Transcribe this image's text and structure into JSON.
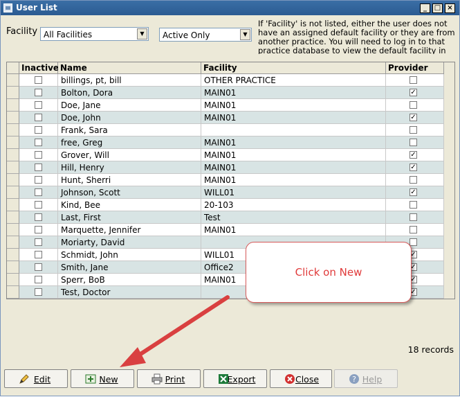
{
  "window": {
    "title": "User List"
  },
  "filters": {
    "facility_label": "Facility",
    "facility_value": "All Facilities",
    "status_value": "Active Only",
    "info_text": "If 'Facility' is not listed, either the user does not have an assigned default facility or they are from another practice. You will need to log in to that practice database to view the default facility in the list."
  },
  "table": {
    "columns": [
      "Inactive",
      "Name",
      "Facility",
      "Provider"
    ],
    "rows": [
      {
        "inactive": false,
        "name": "billings, pt, bill",
        "facility": "OTHER PRACTICE",
        "provider": false
      },
      {
        "inactive": false,
        "name": "Bolton, Dora",
        "facility": "MAIN01",
        "provider": true
      },
      {
        "inactive": false,
        "name": "Doe, Jane",
        "facility": "MAIN01",
        "provider": false
      },
      {
        "inactive": false,
        "name": "Doe, John",
        "facility": "MAIN01",
        "provider": true
      },
      {
        "inactive": false,
        "name": "Frank, Sara",
        "facility": "",
        "provider": false
      },
      {
        "inactive": false,
        "name": "free, Greg",
        "facility": "MAIN01",
        "provider": false
      },
      {
        "inactive": false,
        "name": "Grover, Will",
        "facility": "MAIN01",
        "provider": true
      },
      {
        "inactive": false,
        "name": "Hill, Henry",
        "facility": "MAIN01",
        "provider": true
      },
      {
        "inactive": false,
        "name": "Hunt, Sherri",
        "facility": "MAIN01",
        "provider": false
      },
      {
        "inactive": false,
        "name": "Johnson, Scott",
        "facility": "WILL01",
        "provider": true
      },
      {
        "inactive": false,
        "name": "Kind, Bee",
        "facility": "20-103",
        "provider": false
      },
      {
        "inactive": false,
        "name": "Last, First",
        "facility": "Test",
        "provider": false
      },
      {
        "inactive": false,
        "name": "Marquette, Jennifer",
        "facility": "MAIN01",
        "provider": false
      },
      {
        "inactive": false,
        "name": "Moriarty, David",
        "facility": "",
        "provider": false
      },
      {
        "inactive": false,
        "name": "Schmidt, John",
        "facility": "WILL01",
        "provider": true
      },
      {
        "inactive": false,
        "name": "Smith, Jane",
        "facility": "Office2",
        "provider": true
      },
      {
        "inactive": false,
        "name": "Sperr, BoB",
        "facility": "MAIN01",
        "provider": true
      },
      {
        "inactive": false,
        "name": "Test, Doctor",
        "facility": "",
        "provider": true
      }
    ]
  },
  "records_text": "18 records",
  "buttons": {
    "edit": "Edit",
    "new": "New",
    "print": "Print",
    "export": "Export",
    "close": "Close",
    "help": "Help"
  },
  "annotation": {
    "callout_text": "Click on New"
  },
  "colors": {
    "titlebar": "#2b5b92",
    "row_alt": "#d8e4e4",
    "callout": "#e03a3a"
  },
  "icons": {
    "edit": "pencil-icon",
    "new": "add-icon",
    "print": "printer-icon",
    "export": "excel-icon",
    "close": "close-circle-icon",
    "help": "help-icon"
  }
}
